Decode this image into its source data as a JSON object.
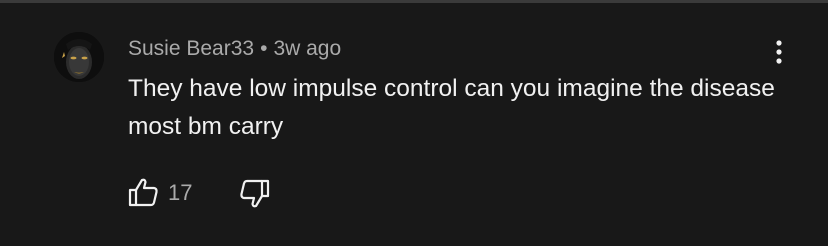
{
  "comment": {
    "author": "Susie Bear33",
    "separator": "•",
    "time": "3w ago",
    "text": "They have low impulse control can you imagine the disease most bm carry",
    "like_count": "17"
  },
  "icons": {
    "avatar": "avatar-image",
    "more": "more-vert-icon",
    "like": "thumbs-up-icon",
    "dislike": "thumbs-down-icon"
  },
  "colors": {
    "background": "#181818",
    "primary_text": "#f1f1f1",
    "secondary_text": "#aaaaaa"
  }
}
